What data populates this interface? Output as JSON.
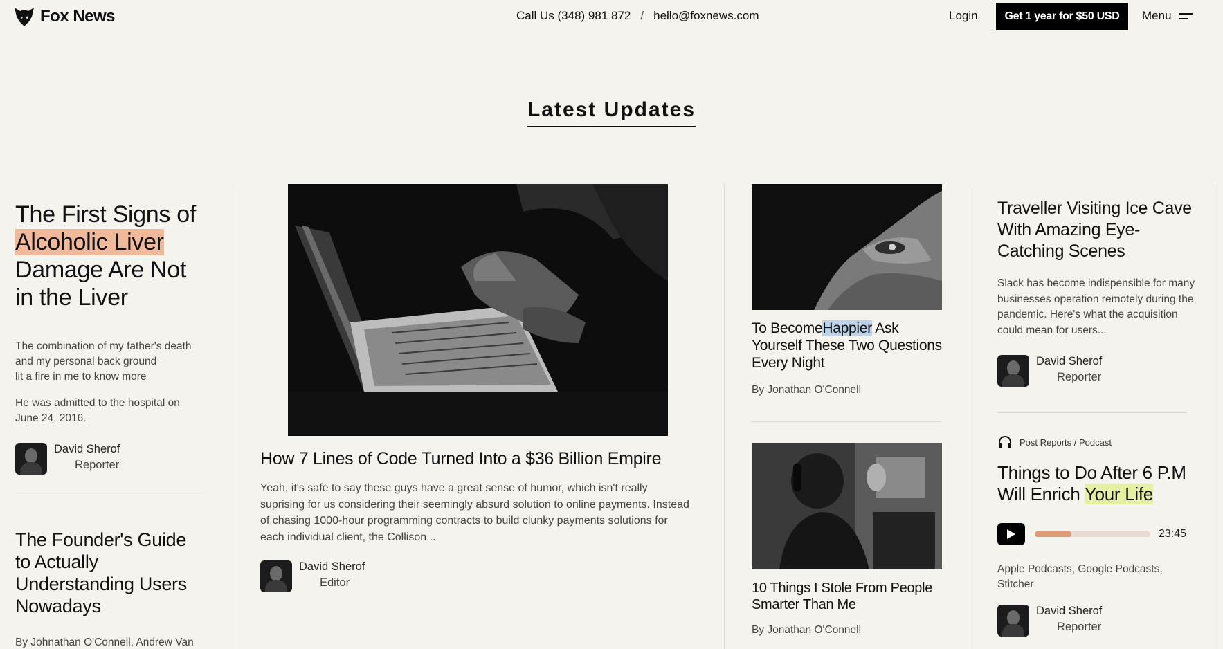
{
  "header": {
    "brand": "Fox News",
    "phone": "Call Us (348) 981 872",
    "separator": "/",
    "email": "hello@foxnews.com",
    "login": "Login",
    "subscribe": "Get 1 year for $50 USD",
    "menu": "Menu"
  },
  "section": {
    "title": "Latest Updates"
  },
  "col1": {
    "article1": {
      "title_pre": "The First Signs of",
      "title_highlight": "Alcoholic Liver",
      "title_post": "Damage Are Not in the Liver",
      "excerpt1_line1": "The combination of my father's death",
      "excerpt1_line2": "and my personal back ground",
      "excerpt1_line3": "lit a fire in me to know more",
      "excerpt2": "He was admitted to the hospital on June 24, 2016.",
      "author": {
        "name": "David Sherof",
        "role": "Reporter"
      }
    },
    "article2": {
      "title": "The Founder's Guide to Actually Understanding Users Nowadays",
      "byline": "By Johnathan O'Connell, Andrew Van Dam, Aaron Gregg and Alyssa Fowers"
    }
  },
  "col2": {
    "title": "How 7 Lines of Code Turned Into a $36 Billion Empire",
    "excerpt": "Yeah, it's safe to say these guys have a great sense of humor, which isn't really suprising for us considering their seemingly absurd solution to online payments. Instead of chasing 1000-hour programming contracts to build clunky payments solutions for each individual client, the Collison...",
    "author": {
      "name": "David Sherof",
      "role": "Editor"
    }
  },
  "col3": {
    "article1": {
      "title_pre": "To Become",
      "title_highlight": "Happier",
      "title_post": " Ask Yourself These Two Questions Every Night",
      "byline": "By Jonathan O'Connell"
    },
    "article2": {
      "title": "10 Things I Stole From People Smarter Than Me",
      "byline": "By Jonathan O'Connell"
    }
  },
  "col4": {
    "article1": {
      "title": "Traveller Visiting Ice Cave With Amazing Eye-Catching Scenes",
      "excerpt": "Slack has become indispensible for many businesses operation remotely during the pandemic. Here's what the acquisition could mean for users...",
      "author": {
        "name": "David Sherof",
        "role": "Reporter"
      }
    },
    "podcast": {
      "category": "Post Reports / Podcast",
      "title_pre": "Things to Do After 6 P.M Will Enrich ",
      "title_highlight": "Your Life",
      "duration": "23:45",
      "progress": 0.32,
      "platforms": "Apple Podcasts, Google Podcasts, Stitcher",
      "author": {
        "name": "David Sherof",
        "role": "Reporter"
      }
    }
  }
}
